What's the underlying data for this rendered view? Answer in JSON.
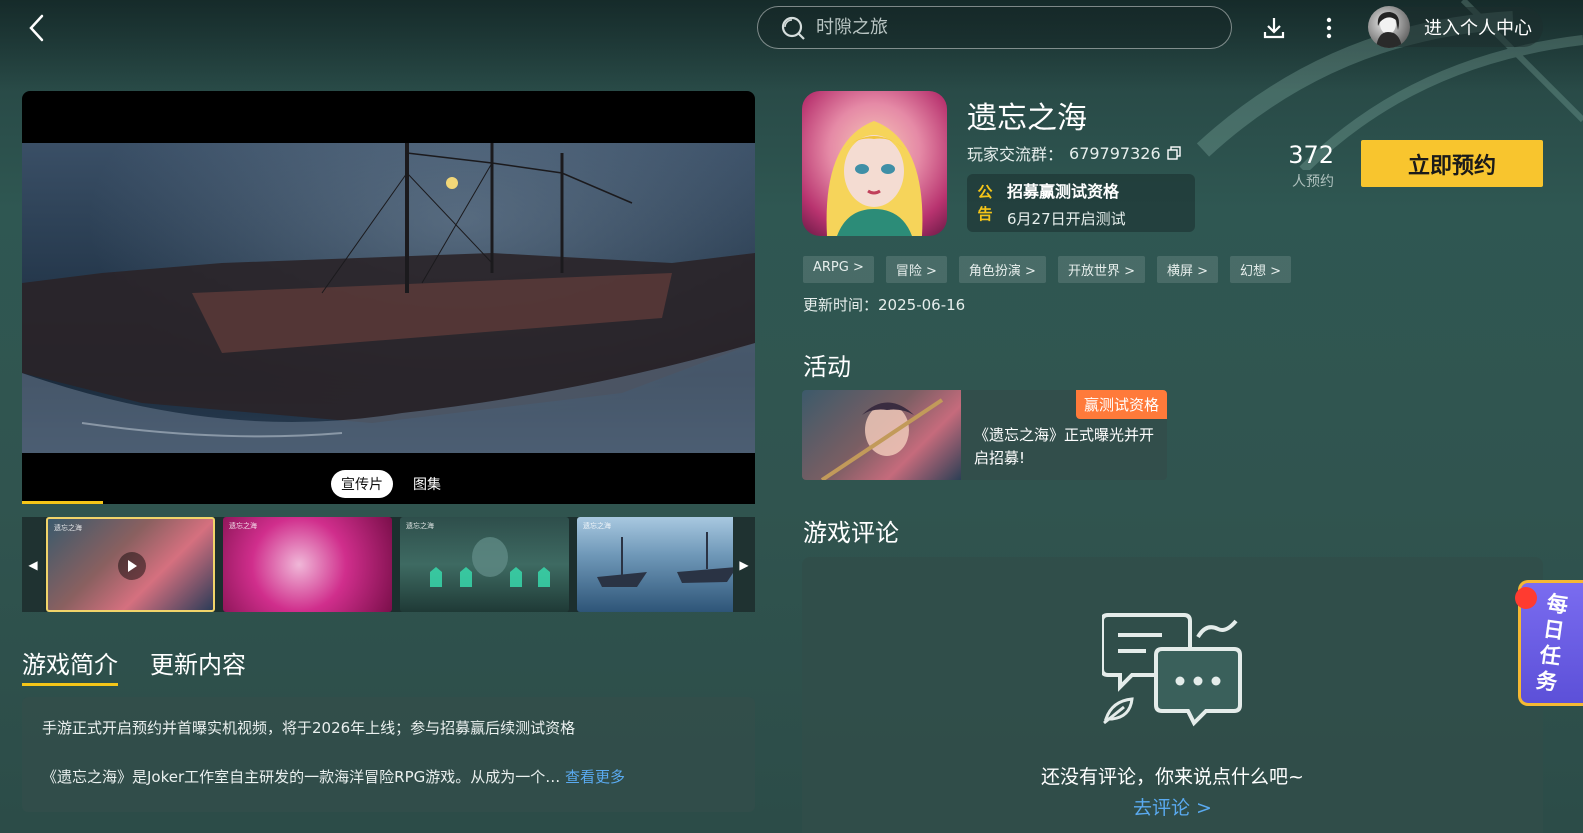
{
  "header": {
    "search_placeholder": "时隙之旅",
    "profile_label": "进入个人中心"
  },
  "media": {
    "tabs": [
      "宣传片",
      "图集"
    ],
    "watermark": "遗忘之海",
    "progress": 0.11
  },
  "intro": {
    "tabs": [
      "游戏简介",
      "更新内容"
    ],
    "line1": "手游正式开启预约并首曝实机视频，将于2026年上线；参与招募赢后续测试资格",
    "line2": "《遗忘之海》是Joker工作室自主研发的一款海洋冒险RPG游戏。从成为一个…",
    "more": "查看更多"
  },
  "game": {
    "title": "遗忘之海",
    "group_label": "玩家交流群：",
    "group_number": "679797326",
    "notice_tag": "公告",
    "notice_line1": "招募赢测试资格",
    "notice_line2": "6月27日开启测试",
    "reserve_count": "372",
    "reserve_count_label": "人预约",
    "reserve_button": "立即预约",
    "tags": [
      "ARPG >",
      "冒险 >",
      "角色扮演 >",
      "开放世界 >",
      "横屏 >",
      "幻想 >"
    ],
    "update_label": "更新时间：",
    "update_date": "2025-06-16"
  },
  "activity": {
    "section_title": "活动",
    "badge": "赢测试资格",
    "desc": "《遗忘之海》正式曝光并开启招募!"
  },
  "comments": {
    "section_title": "游戏评论",
    "empty_text": "还没有评论，你来说点什么吧~",
    "go_comment": "去评论 >"
  },
  "daily_task": "每日任务",
  "colors": {
    "accent_yellow": "#f8c52e",
    "link_blue": "#5aaaf0",
    "badge_orange": "#ff7a3a"
  }
}
